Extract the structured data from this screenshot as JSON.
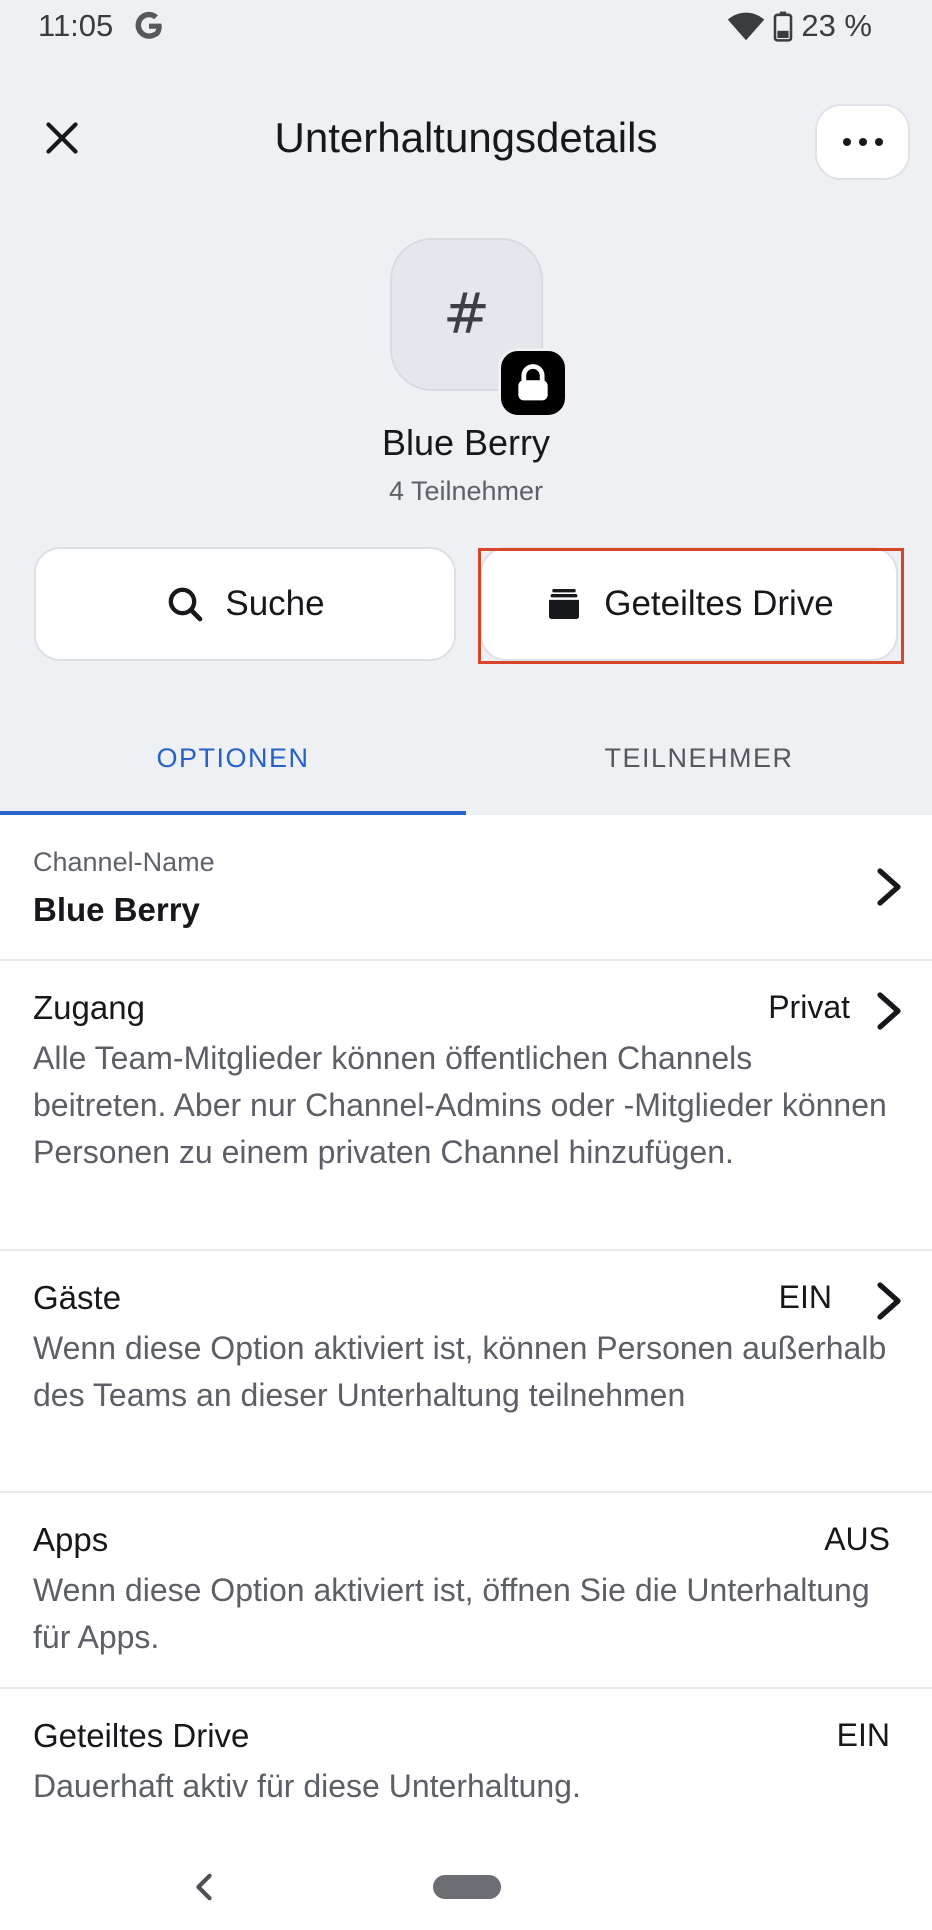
{
  "status_bar": {
    "time": "11:05",
    "battery": "23 %",
    "icons": [
      "google-icon",
      "wifi-icon",
      "battery-icon"
    ]
  },
  "header": {
    "title": "Unterhaltungsdetails",
    "close_icon": "close-icon",
    "more_icon": "more-horizontal-icon"
  },
  "channel": {
    "avatar_symbol": "#",
    "name": "Blue Berry",
    "members": "4 Teilnehmer"
  },
  "actions": {
    "search_label": "Suche",
    "drive_label": "Geteiltes Drive"
  },
  "tabs": {
    "options": "OPTIONEN",
    "members": "TEILNEHMER",
    "active": "options"
  },
  "settings": {
    "channel_name": {
      "label": "Channel-Name",
      "value": "Blue Berry"
    },
    "access": {
      "title": "Zugang",
      "value": "Privat",
      "desc": "Alle Team-Mitglieder können öffentlichen Channels beitreten. Aber nur Channel-Admins oder -Mitglieder können Personen zu einem privaten Channel hinzufügen."
    },
    "guests": {
      "title": "Gäste",
      "value": "EIN",
      "desc": "Wenn diese Option aktiviert ist, können Personen außerhalb des Teams an dieser Unterhaltung teilnehmen"
    },
    "apps": {
      "title": "Apps",
      "value": "AUS",
      "desc": "Wenn diese Option aktiviert ist, öffnen Sie die Unterhaltung für Apps."
    },
    "shared_drive": {
      "title": "Geteiltes Drive",
      "value": "EIN",
      "desc": "Dauerhaft aktiv für diese Unterhaltung."
    }
  },
  "colors": {
    "accent": "#2a66c9",
    "highlight": "#d9452b",
    "background": "#eef0f3"
  }
}
